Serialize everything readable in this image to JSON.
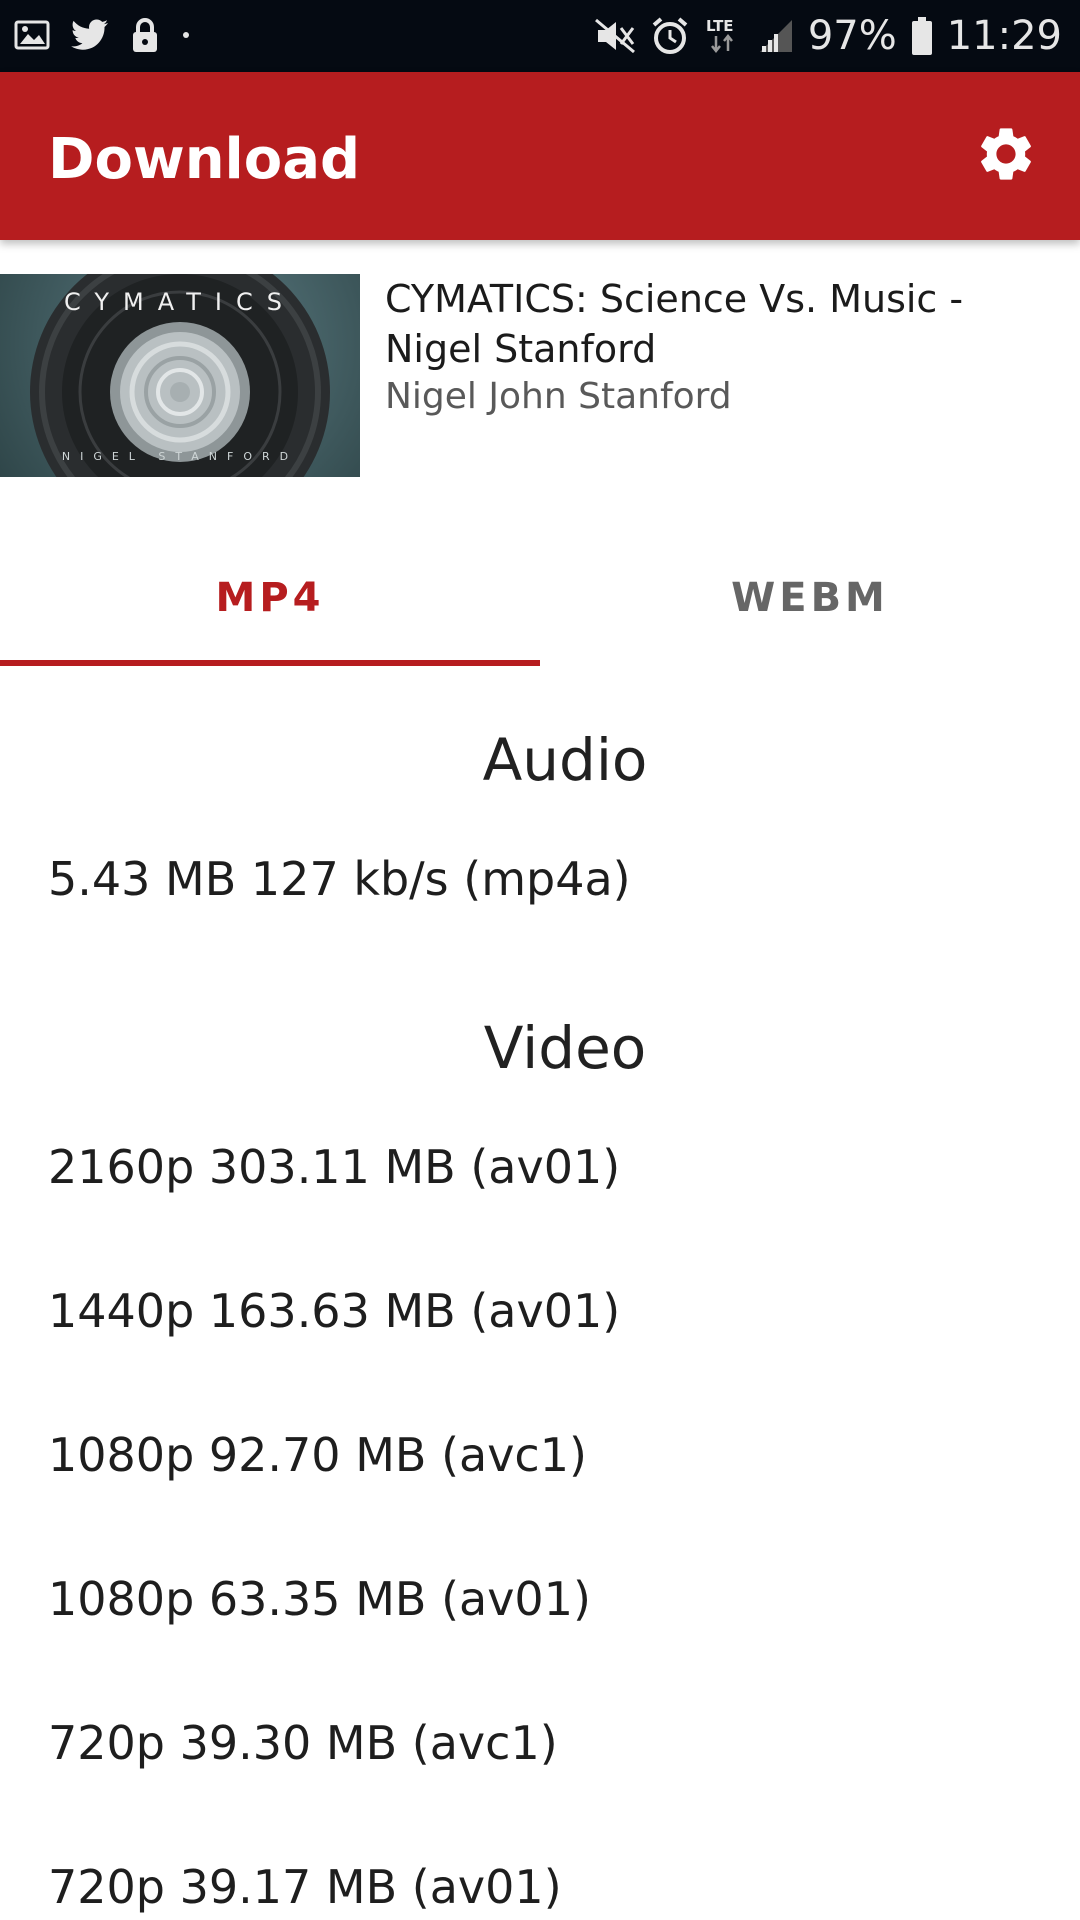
{
  "status_bar": {
    "battery": "97%",
    "time": "11:29",
    "network": "LTE",
    "icons": [
      "image-icon",
      "twitter-icon",
      "lock-icon",
      "dot-icon",
      "mute-icon",
      "alarm-icon",
      "signal-icon",
      "battery-icon"
    ]
  },
  "app_bar": {
    "title": "Download",
    "settings_icon": "gear-icon",
    "color": "#b61d1f"
  },
  "video": {
    "title": "CYMATICS: Science Vs. Music - Nigel Stanford",
    "author": "Nigel John Stanford",
    "thumbnail": {
      "brand_text": "CYMATICS",
      "sub_text": "NIGEL STANFORD"
    }
  },
  "tabs": [
    {
      "label": "MP4",
      "selected": true
    },
    {
      "label": "WEBM",
      "selected": false
    }
  ],
  "audio": {
    "heading": "Audio",
    "items": [
      "5.43 MB 127 kb/s (mp4a)"
    ]
  },
  "video_formats": {
    "heading": "Video",
    "items": [
      "2160p 303.11 MB (av01)",
      "1440p 163.63 MB (av01)",
      "1080p 92.70 MB (avc1)",
      "1080p 63.35 MB (av01)",
      "720p 39.30 MB (avc1)",
      "720p 39.17 MB (av01)"
    ]
  }
}
